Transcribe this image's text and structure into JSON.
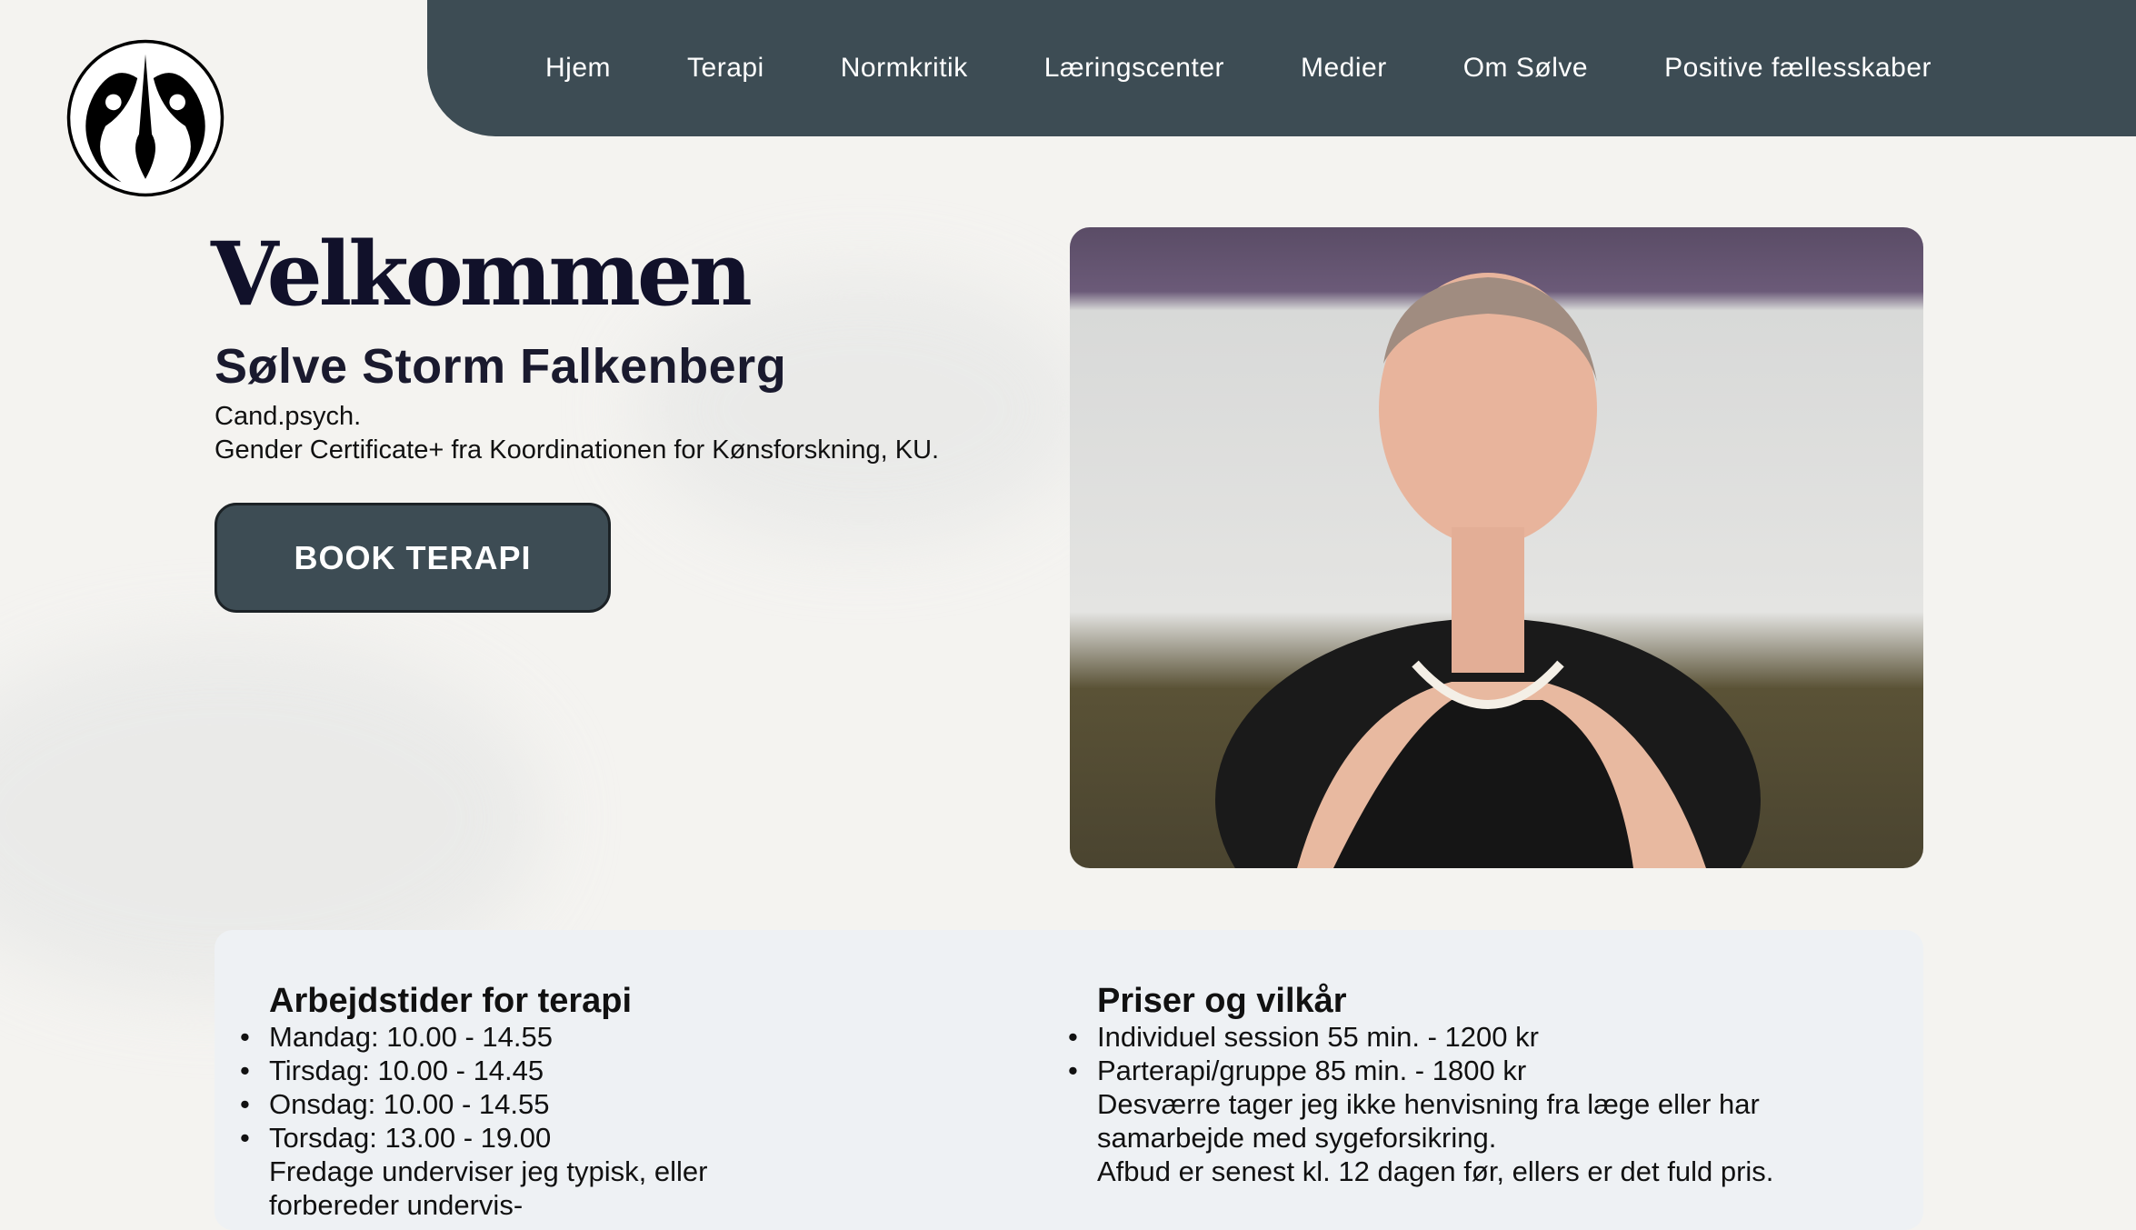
{
  "nav": {
    "items": [
      "Hjem",
      "Terapi",
      "Normkritik",
      "Læringscenter",
      "Medier",
      "Om Sølve",
      "Positive fællesskaber"
    ]
  },
  "hero": {
    "title": "Velkommen",
    "name": "Sølve Storm Falkenberg",
    "degree": "Cand.psych.",
    "certificate": "Gender Certificate+ fra Koordinationen for Kønsforskning, KU.",
    "button": "BOOK TERAPI"
  },
  "hours": {
    "title": "Arbejdstider for terapi",
    "items": [
      "Mandag: 10.00 - 14.55",
      "Tirsdag: 10.00 - 14.45",
      "Onsdag: 10.00 - 14.55",
      "Torsdag: 13.00 - 19.00"
    ],
    "note": "Fredage underviser jeg typisk, eller forbereder undervis-"
  },
  "prices": {
    "title": "Priser og vilkår",
    "items": [
      "Individuel session 55 min. - 1200 kr",
      "Parterapi/gruppe 85 min. - 1800 kr"
    ],
    "note1": "Desværre tager jeg ikke henvisning fra læge eller har samarbejde med sygeforsikring.",
    "note2": "Afbud er senest kl. 12 dagen før, ellers er det fuld pris."
  },
  "colors": {
    "nav": "#3d4c54",
    "card": "#eef1f4"
  }
}
